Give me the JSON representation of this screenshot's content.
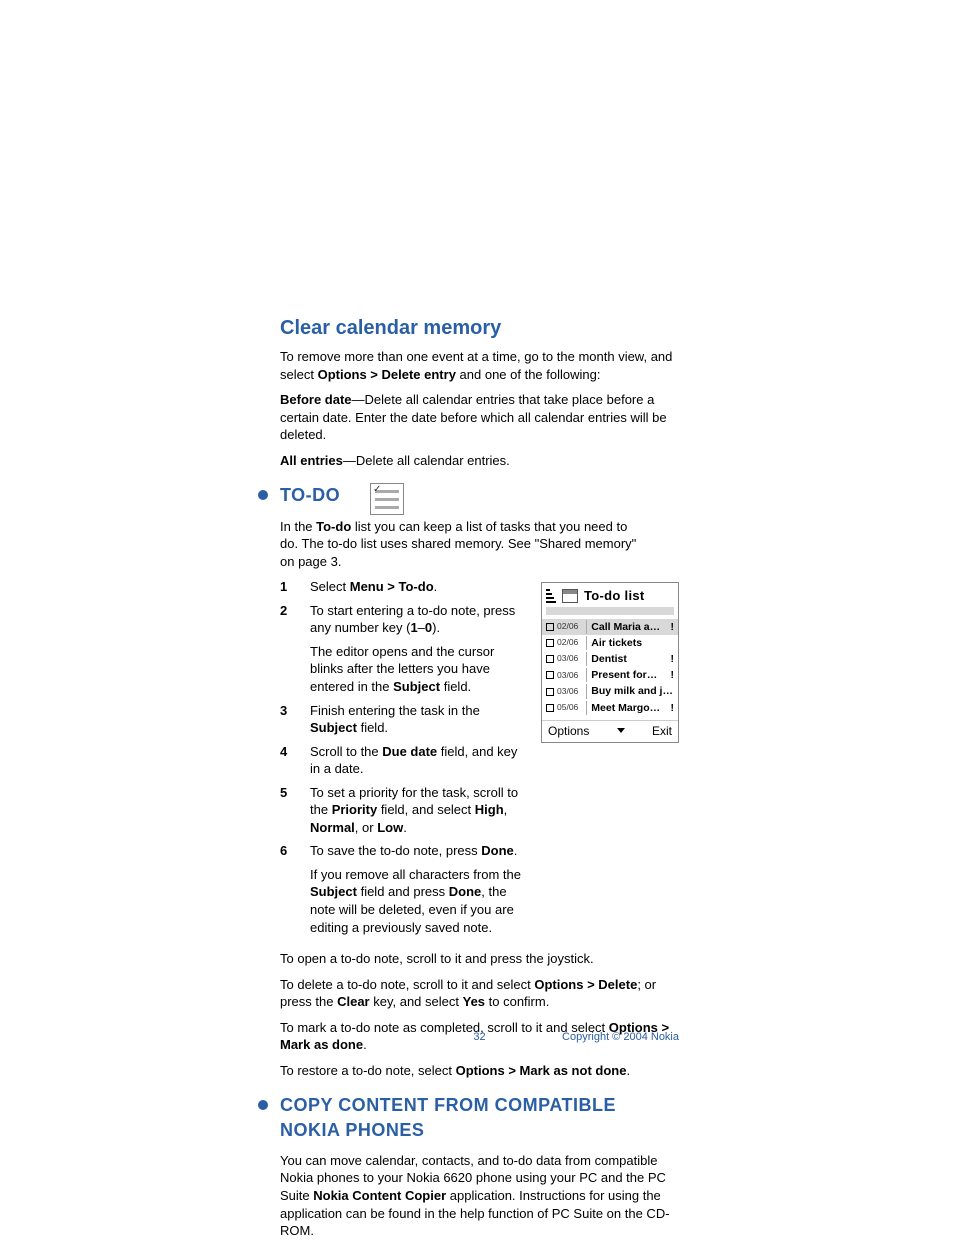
{
  "section1": {
    "heading": "Clear calendar memory",
    "p1_a": "To remove more than one event at a time, go to the month view, and select ",
    "p1_b": "Options > Delete entry",
    "p1_c": " and one of the following:",
    "p2_a": "Before date",
    "p2_b": "—Delete all calendar entries that take place before a certain date. Enter the date before which all calendar entries will be deleted.",
    "p3_a": "All entries",
    "p3_b": "—Delete all calendar entries."
  },
  "section2": {
    "heading": "TO-DO",
    "intro_a": "In the ",
    "intro_b": "To-do",
    "intro_c": " list you can keep a list of tasks that you need to do. The to-do list uses shared memory. See \"Shared memory\" on page 3.",
    "steps": [
      {
        "n": "1",
        "html": "Select <b>Menu > To-do</b>."
      },
      {
        "n": "2",
        "html": "To start entering a to-do note, press any number key (<b>1</b>–<b>0</b>)."
      },
      {
        "n": "",
        "html": "The editor opens and the cursor blinks after the letters you have entered in the <b>Subject</b> field."
      },
      {
        "n": "3",
        "html": "Finish entering the task in the <b>Subject</b> field."
      },
      {
        "n": "4",
        "html": "Scroll to the <b>Due date</b> field, and key in a date."
      },
      {
        "n": "5",
        "html": "To set a priority for the task, scroll to the <b>Priority</b> field, and select <b>High</b>, <b>Normal</b>, or <b>Low</b>."
      },
      {
        "n": "6",
        "html": "To save the to-do note, press <b>Done</b>."
      },
      {
        "n": "",
        "html": "If you remove all characters from the <b>Subject</b> field and press <b>Done</b>, the note will be deleted, even if you are editing a previously saved note."
      }
    ],
    "after": [
      "To open a to-do note, scroll to it and press the joystick.",
      "To delete a to-do note, scroll to it and select <b>Options > Delete</b>; or press the <b>Clear</b> key, and select <b>Yes</b> to confirm.",
      "To mark a to-do note as completed, scroll to it and select <b>Options > Mark as done</b>.",
      "To restore a to-do note, select <b>Options > Mark as not done</b>."
    ]
  },
  "phone": {
    "title": "To-do list",
    "rows": [
      {
        "date": "02/06",
        "label": "Call Maria a…",
        "excl": true,
        "hl": true
      },
      {
        "date": "02/06",
        "label": "Air tickets",
        "excl": false
      },
      {
        "date": "03/06",
        "label": "Dentist",
        "excl": true
      },
      {
        "date": "03/06",
        "label": "Present for…",
        "excl": true
      },
      {
        "date": "03/06",
        "label": "Buy milk and j…",
        "excl": false
      },
      {
        "date": "05/06",
        "label": "Meet Margo…",
        "excl": true
      }
    ],
    "left": "Options",
    "right": "Exit"
  },
  "section3": {
    "heading": "COPY CONTENT FROM COMPATIBLE NOKIA PHONES",
    "p_a": "You can move calendar, contacts, and to-do data from compatible Nokia phones to your Nokia 6620 phone using your PC and the PC Suite ",
    "p_b": "Nokia Content Copier",
    "p_c": " application. Instructions for using the application can be found in the help function of PC Suite on the CD-ROM."
  },
  "footer": {
    "page": "32",
    "copyright": "Copyright © 2004 Nokia"
  }
}
